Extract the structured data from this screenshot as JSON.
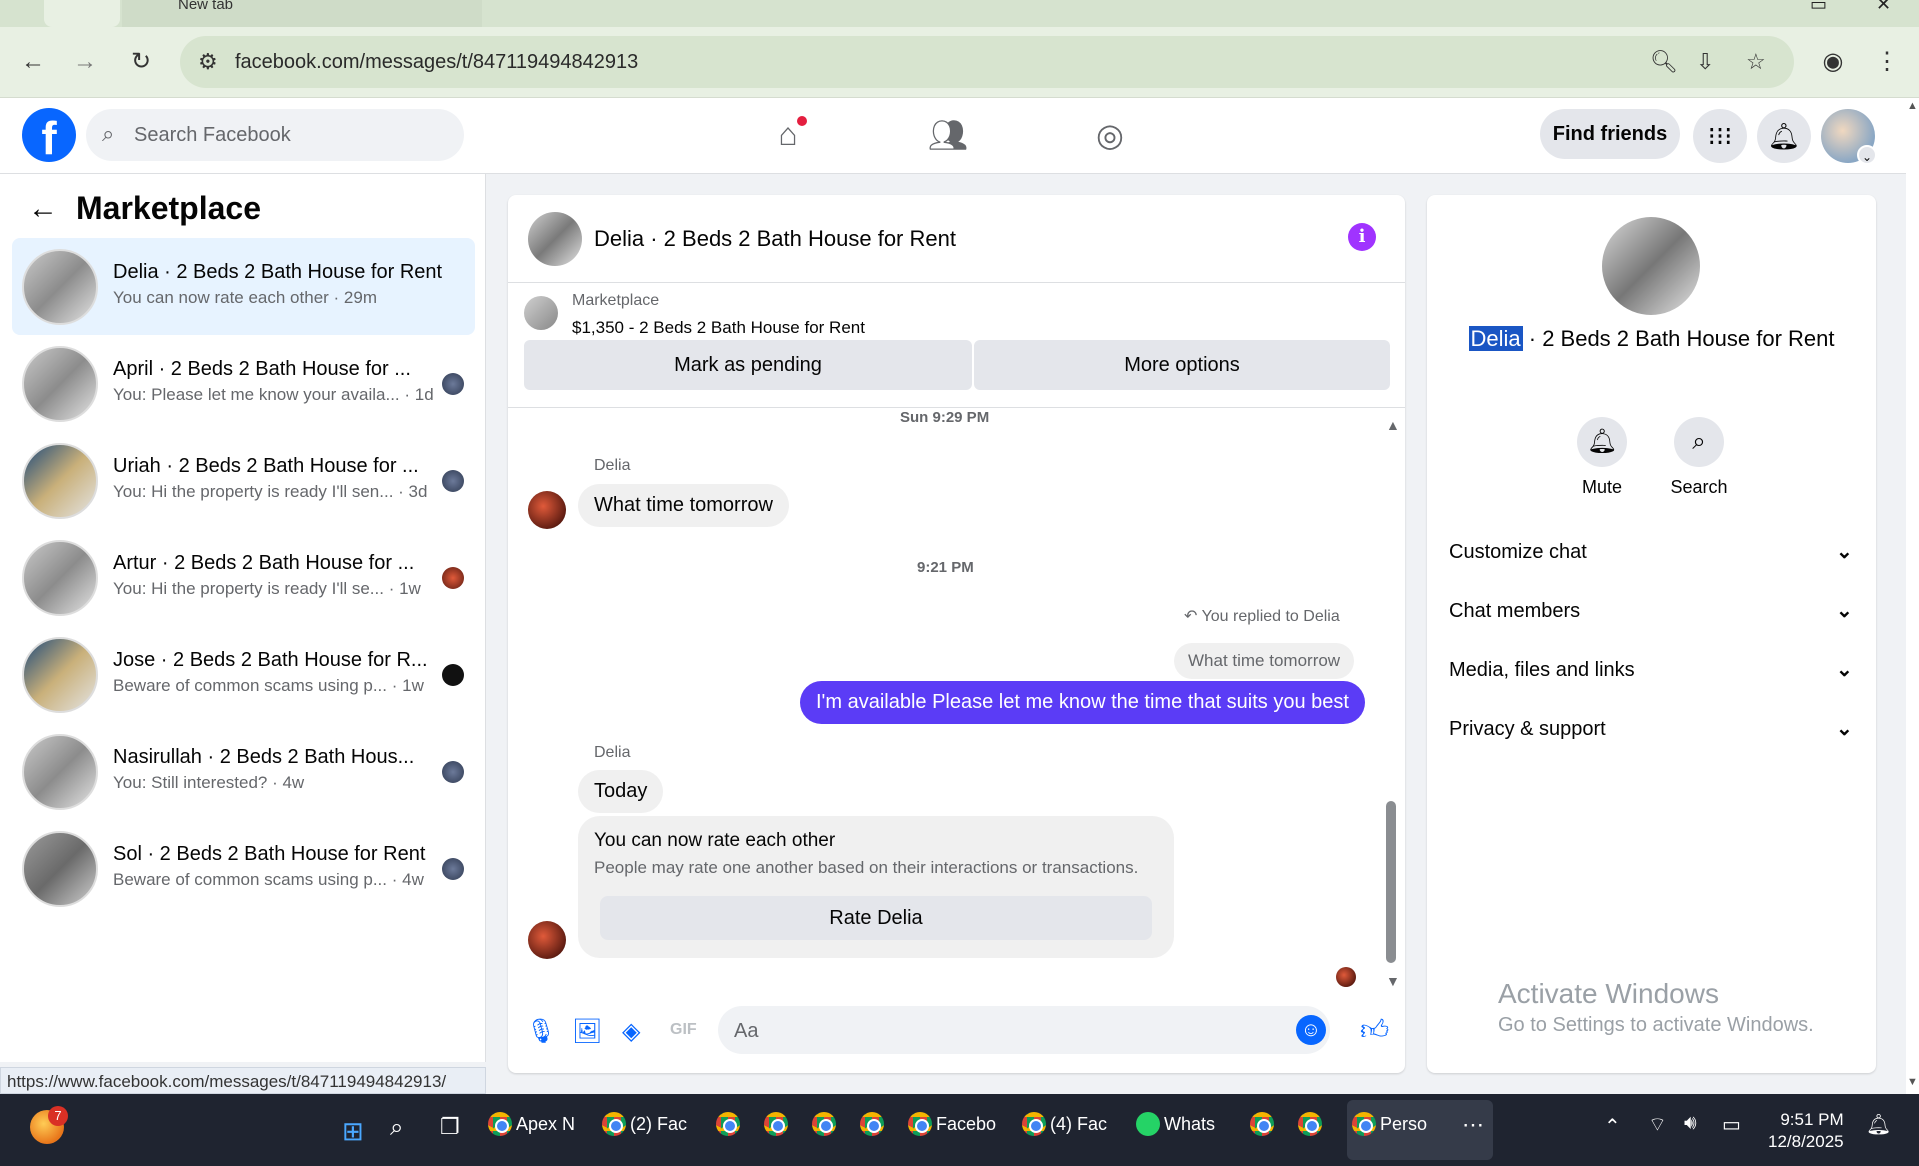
{
  "browser": {
    "tab_title": "New tab",
    "url": "facebook.com/messages/t/847119494842913",
    "hover_url": "https://www.facebook.com/messages/t/847119494842913/"
  },
  "header": {
    "search_placeholder": "Search Facebook",
    "find_friends": "Find friends"
  },
  "sidebar": {
    "title": "Marketplace",
    "conversations": [
      {
        "name": "Delia · 2 Beds 2 Bath House for Rent",
        "preview": "You can now rate each other · 29m",
        "active": true
      },
      {
        "name": "April · 2 Beds 2 Bath House for ...",
        "preview": "You: Please let me know your availa... · 1d"
      },
      {
        "name": "Uriah · 2 Beds 2 Bath House for ...",
        "preview": "You: Hi the property is ready I'll sen... · 3d"
      },
      {
        "name": "Artur · 2 Beds 2 Bath House for ...",
        "preview": "You: Hi the property is ready I'll se... · 1w"
      },
      {
        "name": "Jose · 2 Beds 2 Bath House for R...",
        "preview": "Beware of common scams using p... · 1w"
      },
      {
        "name": "Nasirullah · 2 Beds 2 Bath Hous...",
        "preview": "You: Still interested? · 4w"
      },
      {
        "name": "Sol · 2 Beds 2 Bath House for Rent",
        "preview": "Beware of common scams using p... · 4w"
      }
    ]
  },
  "chat": {
    "title": "Delia · 2 Beds 2 Bath House for Rent",
    "listing_label": "Marketplace",
    "listing_price": "$1,350 - 2 Beds 2 Bath House for Rent",
    "mark_pending": "Mark as pending",
    "more_options": "More options",
    "stamp1": "Sun 9:29 PM",
    "sender1": "Delia",
    "msg1": "What time tomorrow",
    "stamp2": "9:21 PM",
    "reply_note": "You replied to Delia",
    "quoted": "What time tomorrow",
    "my_msg": "I'm available Please let me know the time that suits you best",
    "sender2": "Delia",
    "msg2": "Today",
    "rate_title": "You can now rate each other",
    "rate_sub": "People may rate one another based on their interactions or transactions.",
    "rate_btn": "Rate Delia",
    "composer_placeholder": "Aa"
  },
  "info": {
    "title_name": "Delia",
    "title_rest": " · 2 Beds 2 Bath House for Rent",
    "mute": "Mute",
    "search": "Search",
    "rows": [
      "Customize chat",
      "Chat members",
      "Media, files and links",
      "Privacy & support"
    ]
  },
  "activate": {
    "line1": "Activate Windows",
    "line2": "Go to Settings to activate Windows."
  },
  "taskbar": {
    "badge": "7",
    "apps": [
      "Apex N",
      "(2) Fac",
      "Facebo",
      "(4) Fac",
      "Whats",
      "Perso"
    ],
    "time": "9:51 PM",
    "date": "12/8/2025"
  },
  "colors": {
    "fb_blue": "#0866ff",
    "outgoing_bubble": "#5b3cf6",
    "info_purple": "#a033ff"
  }
}
